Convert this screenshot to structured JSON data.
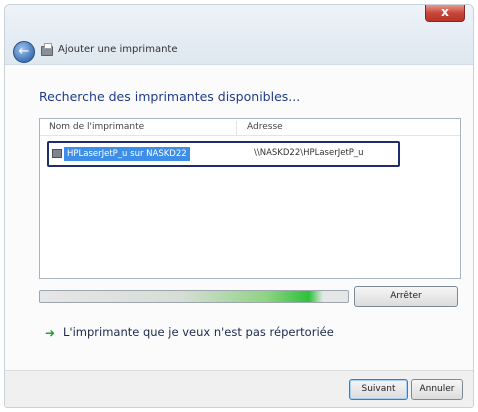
{
  "window": {
    "title": "Ajouter une imprimante",
    "close_label": "x"
  },
  "main": {
    "heading": "Recherche des imprimantes disponibles...",
    "list": {
      "columns": [
        "Nom de l'imprimante",
        "Adresse"
      ],
      "rows": [
        {
          "name": "HPLaserJetP_u sur NASKD22",
          "address": "\\\\NASKD22\\HPLaserJetP_u"
        }
      ]
    },
    "progress": 0.92,
    "stop_label": "Arrêter",
    "not_listed_label": "L'imprimante que je veux n'est pas répertoriée"
  },
  "footer": {
    "next_label": "Suivant",
    "cancel_label": "Annuler"
  },
  "colors": {
    "selection": "#3c8ee8",
    "heading": "#1f3b8a",
    "progress": "#2cc23a"
  },
  "icons": {
    "back": "back-arrow-icon",
    "printer": "printer-icon",
    "link": "green-arrow-icon"
  }
}
